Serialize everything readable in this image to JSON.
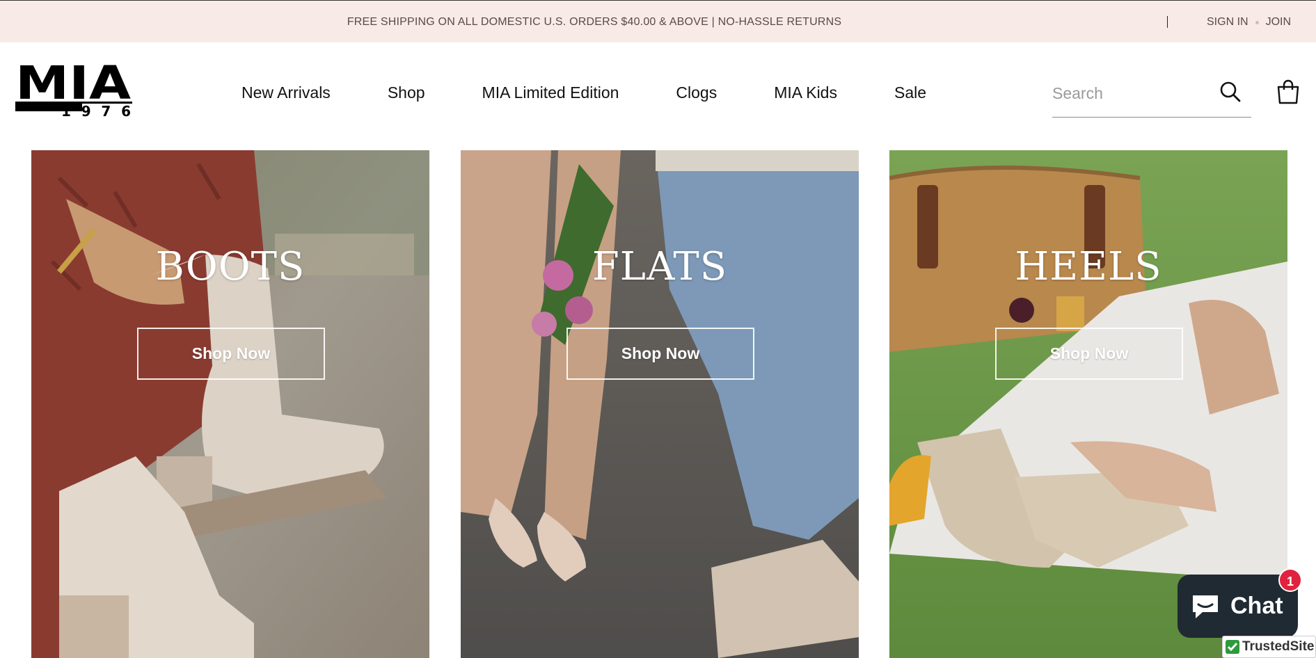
{
  "announcement": {
    "text": "FREE SHIPPING ON ALL DOMESTIC U.S. ORDERS $40.00 & ABOVE | NO-HASSLE RETURNS",
    "sign_in": "SIGN IN",
    "join": "JOIN"
  },
  "logo": {
    "brand": "MIA",
    "year": "1976"
  },
  "nav": {
    "items": [
      "New Arrivals",
      "Shop",
      "MIA Limited Edition",
      "Clogs",
      "MIA Kids",
      "Sale"
    ]
  },
  "search": {
    "placeholder": "Search"
  },
  "categories": [
    {
      "title": "BOOTS",
      "button": "Shop Now"
    },
    {
      "title": "FLATS",
      "button": "Shop Now"
    },
    {
      "title": "HEELS",
      "button": "Shop Now"
    }
  ],
  "chat": {
    "label": "Chat",
    "badge": "1"
  },
  "trusted": {
    "label": "TrustedSite",
    "mark": "®"
  },
  "colors": {
    "announce_bg": "#f8ebe7",
    "chat_bg": "#1f2a33",
    "badge": "#e0223f"
  }
}
